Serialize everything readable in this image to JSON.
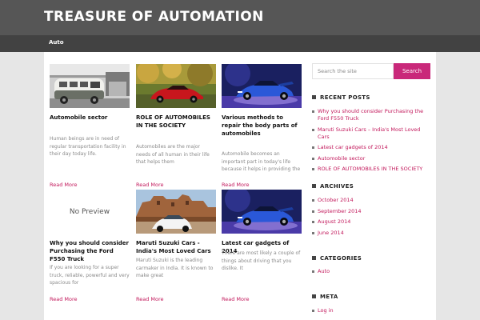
{
  "site": {
    "title": "TREASURE OF AUTOMATION"
  },
  "nav": {
    "items": [
      {
        "label": "Auto"
      }
    ]
  },
  "posts": [
    {
      "title": "Automobile sector",
      "excerpt": "Human beings are in need of regular transportation facility in their day today life.",
      "read_more": "Read More",
      "thumb": "vintage-van-photo"
    },
    {
      "title": "ROLE OF AUTOMOBILES IN THE SOCIETY",
      "excerpt": "Automobiles are the major needs of all human in their life that helps them",
      "read_more": "Read More",
      "thumb": "red-sports-car-photo"
    },
    {
      "title": "Various methods to repair the body parts of automobiles",
      "excerpt": "Automobile becomes an important part in today's life because it helps in providing the",
      "read_more": "Read More",
      "thumb": "blue-car-night-photo"
    },
    {
      "title": "Why you should consider Purchasing the Ford F550 Truck",
      "excerpt": "If you are looking for a super truck, reliable, powerful and very spacious for",
      "read_more": "Read More",
      "thumb": "no-preview",
      "no_preview_text": "No Preview"
    },
    {
      "title": "Maruti Suzuki Cars - India's Most Loved Cars",
      "excerpt": "Maruti Suzuki is the leading carmaker in India. It is known to make great",
      "read_more": "Read More",
      "thumb": "white-car-fort-photo"
    },
    {
      "title": "Latest car gadgets of 2014",
      "excerpt": "There are most likely a couple of things about driving that you dislike. It",
      "read_more": "Read More",
      "thumb": "blue-car-night-photo"
    }
  ],
  "sidebar": {
    "search": {
      "placeholder": "Search the site",
      "button": "Search"
    },
    "recent_posts": {
      "title": "RECENT POSTS",
      "items": [
        "Why you should consider Purchasing the Ford F550 Truck",
        "Maruti Suzuki Cars – India's Most Loved Cars",
        "Latest car gadgets of 2014",
        "Automobile sector",
        "ROLE OF AUTOMOBILES IN THE SOCIETY"
      ]
    },
    "archives": {
      "title": "ARCHIVES",
      "items": [
        "October 2014",
        "September 2014",
        "August 2014",
        "June 2014"
      ]
    },
    "categories": {
      "title": "CATEGORIES",
      "items": [
        "Auto"
      ]
    },
    "meta": {
      "title": "META",
      "items": [
        "Log in"
      ]
    }
  },
  "colors": {
    "header": "#565656",
    "navbar": "#424242",
    "accent": "#c9287a",
    "link": "#c2185b",
    "page_bg": "#e6e6e6"
  }
}
